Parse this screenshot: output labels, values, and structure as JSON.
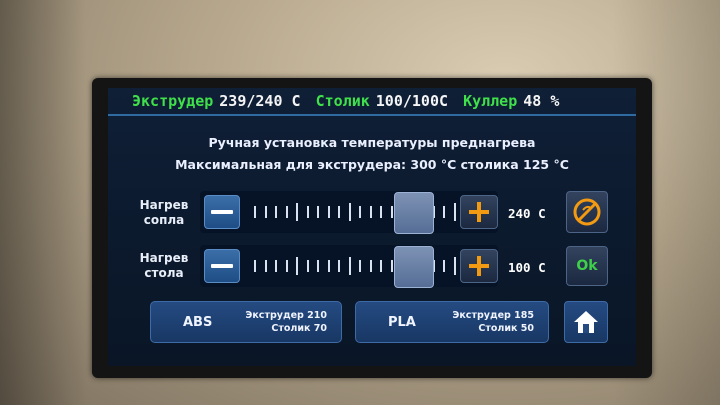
{
  "status_bar": {
    "extruder_label": "Экструдер",
    "extruder_value": "239/240 C",
    "bed_label": "Столик",
    "bed_value": "100/100C",
    "cooler_label": "Куллер",
    "cooler_value": "48 %"
  },
  "header": {
    "title": "Ручная установка температуры преднагрева",
    "limits": "Максимальная для экструдера: 300 °C  столика 125 °C"
  },
  "nozzle_row": {
    "label_line1": "Нагрев",
    "label_line2": "сопла",
    "value": "240 C",
    "slider_level_percent": 60,
    "action_icon": "fan-off-icon"
  },
  "bed_row": {
    "label_line1": "Нагрев",
    "label_line2": "стола",
    "value": "100 C",
    "slider_level_percent": 60,
    "action_label": "Ok"
  },
  "presets": [
    {
      "name": "ABS",
      "line1": "Экструдер 210",
      "line2": "Столик  70"
    },
    {
      "name": "PLA",
      "line1": "Экструдер 185",
      "line2": "Столик  50"
    }
  ],
  "home_icon": "home-icon",
  "colors": {
    "status_green": "#3fe04a",
    "accent_orange": "#f29a12",
    "ok_green": "#3fd04a",
    "panel_blue": "#1f4d85"
  }
}
